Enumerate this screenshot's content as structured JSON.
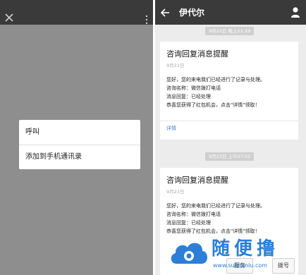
{
  "left_panel": {
    "popup": {
      "items": [
        {
          "label": "呼叫"
        },
        {
          "label": "添加到手机通讯录"
        }
      ]
    }
  },
  "right_panel": {
    "header": {
      "title": "伊代尔"
    },
    "messages": [
      {
        "timestamp": "9月22日 晚上21:29",
        "title": "咨询回复消息提醒",
        "date": "9月22日",
        "lines": [
          "您好，您的来电我们已经进行了记录与处理。",
          "咨询名称：微信拨打电话",
          "消息回复：已经处理",
          "恭喜您获得了红包机会，点击\"详情\"领取！"
        ],
        "link": "详情"
      },
      {
        "timestamp": "9月23日 上午07:02",
        "title": "咨询回复消息提醒",
        "date": "9月23日",
        "lines": [
          "您好，您的来电我们已经进行了记录与处理。",
          "咨询名称：微信拨打电话",
          "消息回复：已经处理",
          "恭喜您获得了红包机会，点击\"详情\"领取！"
        ]
      }
    ],
    "bottom_actions": {
      "call_label": "服务",
      "dial_label": "拨号"
    }
  },
  "watermark": {
    "brand": "随便撸",
    "url": "www.suibianlu.com",
    "icon": "cloud-logo"
  },
  "colors": {
    "topbar": "#3a3a3a",
    "overlay": "#8e8e8e",
    "chat_bg": "#ececec",
    "link": "#4a7fc0",
    "watermark": "#2b7fd6"
  }
}
